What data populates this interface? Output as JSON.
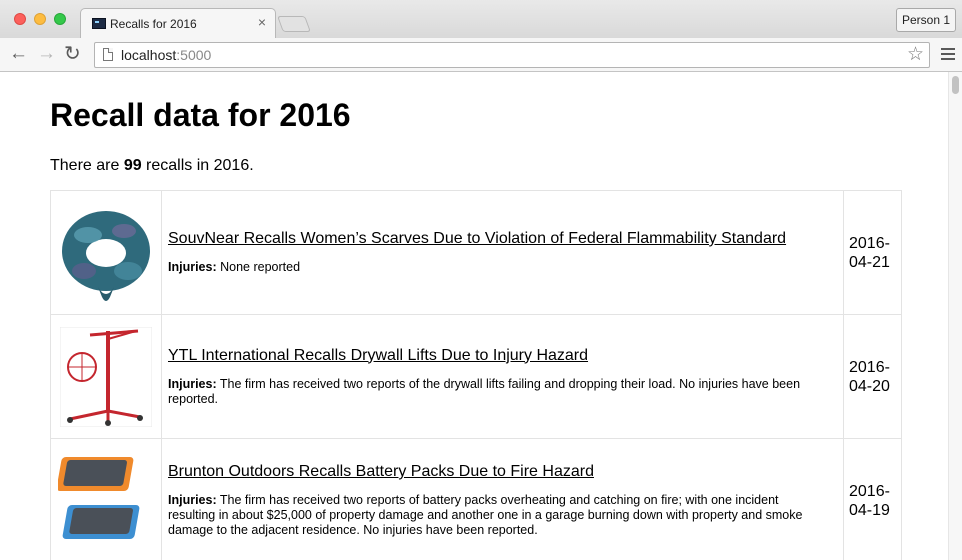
{
  "browser": {
    "tab_title": "Recalls for 2016",
    "tab_close": "×",
    "person_label": "Person 1",
    "url_host": "localhost",
    "url_port": ":5000",
    "back_icon": "←",
    "forward_icon": "→",
    "reload_icon": "↻",
    "star_icon": "☆"
  },
  "page": {
    "title": "Recall data for 2016",
    "summary_prefix": "There are ",
    "summary_count": "99",
    "summary_suffix": " recalls in 2016.",
    "injuries_label": "Injuries:"
  },
  "recalls": [
    {
      "title": "SouvNear Recalls Women’s Scarves Due to Violation of Federal Flammability Standard",
      "injuries": "None reported",
      "date_line1": "2016-",
      "date_line2": "04-21",
      "image": "scarf-image"
    },
    {
      "title": "YTL International Recalls Drywall Lifts Due to Injury Hazard",
      "injuries": "The firm has received two reports of the drywall lifts failing and dropping their load. No injuries have been reported.",
      "date_line1": "2016-",
      "date_line2": "04-20",
      "image": "drywall-lift-image"
    },
    {
      "title": "Brunton Outdoors Recalls Battery Packs Due to Fire Hazard",
      "injuries": "The firm has received two reports of battery packs overheating and catching on fire; with one incident resulting in about $25,000 of property damage and another one in a garage burning down with property and smoke damage to the adjacent residence. No injuries have been reported.",
      "date_line1": "2016-",
      "date_line2": "04-19",
      "image": "battery-pack-image"
    }
  ],
  "colors": {
    "scarf_teal": "#2f6a7c",
    "lift_red": "#c4262e",
    "battery_orange": "#f08a2c",
    "battery_blue": "#3d8fd1"
  }
}
